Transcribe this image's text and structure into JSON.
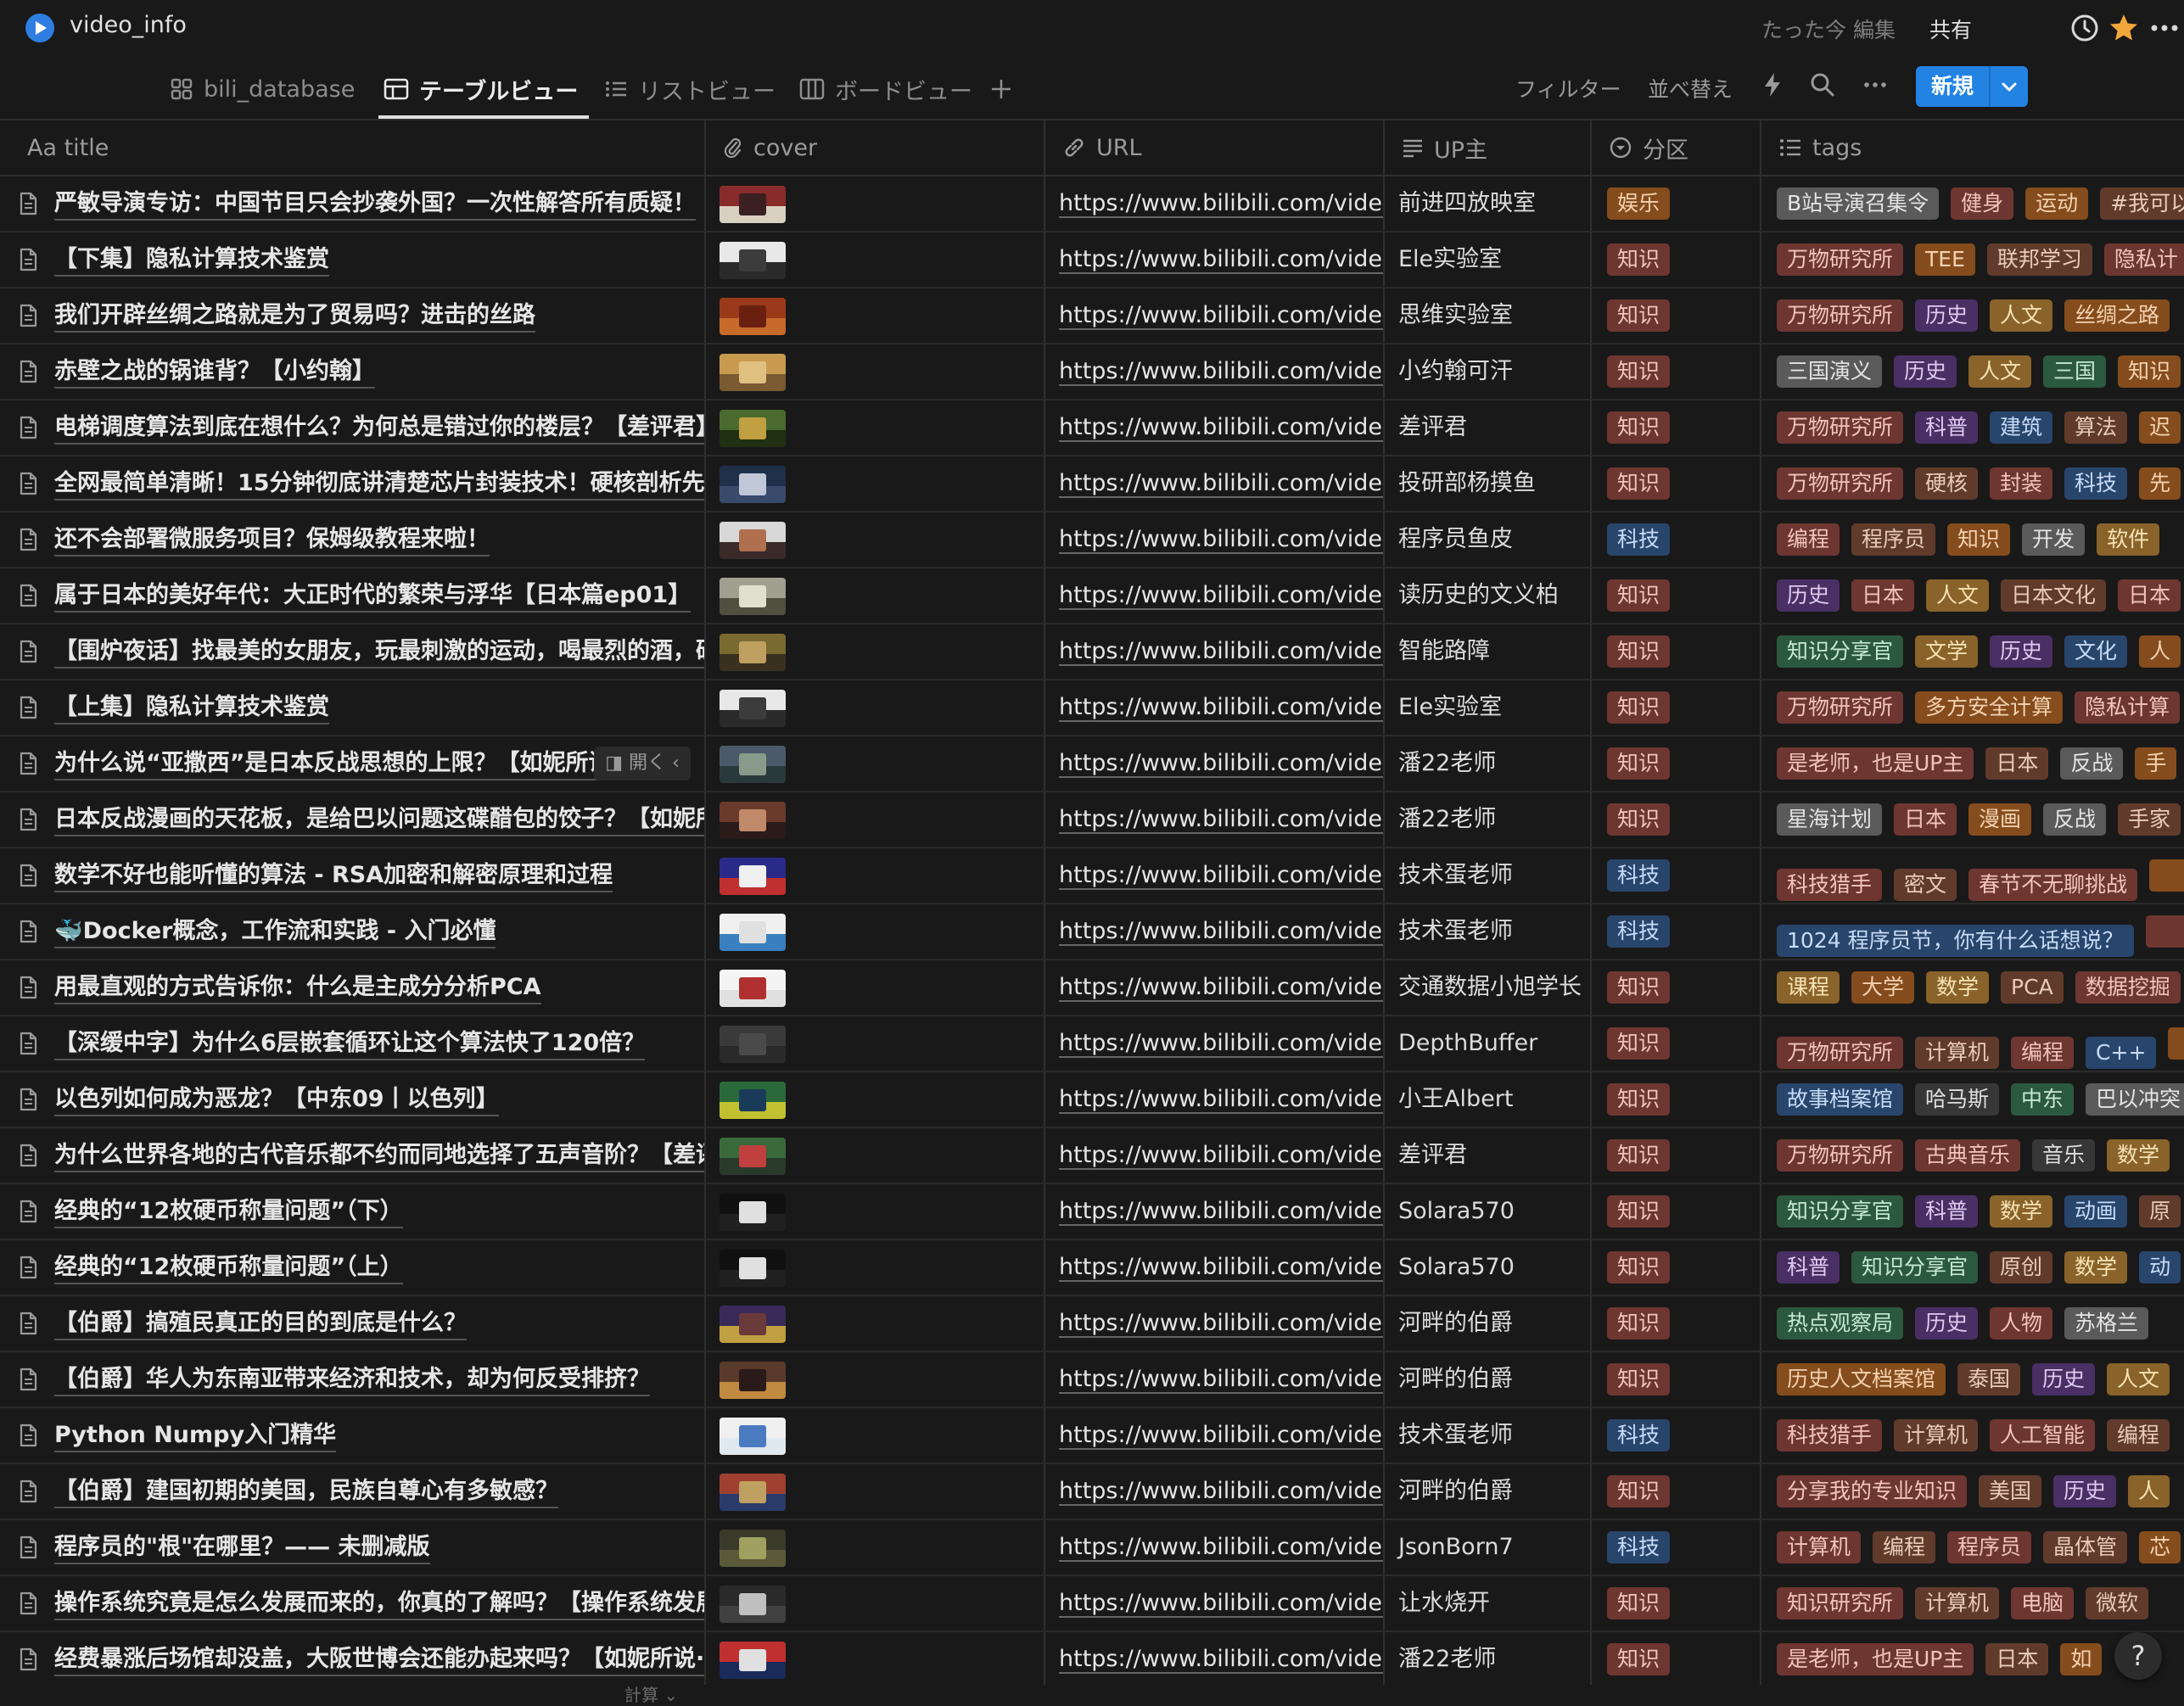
{
  "topbar": {
    "page_title": "video_info",
    "edited": "たった今 編集",
    "share": "共有"
  },
  "views": {
    "tabs": [
      {
        "label": "bili_database",
        "icon": "grid-icon"
      },
      {
        "label": "テーブルビュー",
        "icon": "table-icon",
        "active": true
      },
      {
        "label": "リストビュー",
        "icon": "list-icon"
      },
      {
        "label": "ボードビュー",
        "icon": "board-icon"
      }
    ],
    "filter": "フィルター",
    "sort": "並べ替え",
    "new_label": "新規"
  },
  "columns": {
    "title": "Aa title",
    "cover": "cover",
    "url": "URL",
    "up": "UP主",
    "category": "分区",
    "tags": "tags"
  },
  "colors": {
    "background": "#191919",
    "accent": "#2383e2"
  },
  "hover_open": "開く",
  "calc_label": "計算 ⌄",
  "help_label": "?",
  "rows": [
    {
      "title": "严敏导演专访：中国节目只会抄袭外国？一次性解答所有质疑！",
      "url": "https://www.bilibili.com/video/",
      "up": "前进四放映室",
      "category": "娱乐",
      "cat_color": "orange",
      "thumb": [
        "#8a2b2b",
        "#d8d0c0",
        "#3a2020"
      ],
      "tags": [
        {
          "t": "B站导演召集令",
          "c": "gray"
        },
        {
          "t": "健身",
          "c": "red"
        },
        {
          "t": "运动",
          "c": "orange"
        },
        {
          "t": "#我可以",
          "c": "brown"
        }
      ]
    },
    {
      "title": "【下集】隐私计算技术鉴赏",
      "url": "https://www.bilibili.com/video/",
      "up": "Ele实验室",
      "category": "知识",
      "cat_color": "red",
      "thumb": [
        "#e8e8e8",
        "#2a2a2a",
        "#3c3c3c"
      ],
      "tags": [
        {
          "t": "万物研究所",
          "c": "red"
        },
        {
          "t": "TEE",
          "c": "orange"
        },
        {
          "t": "联邦学习",
          "c": "brown"
        },
        {
          "t": "隐私计",
          "c": "red"
        }
      ]
    },
    {
      "title": "我们开辟丝绸之路就是为了贸易吗？进击的丝路",
      "url": "https://www.bilibili.com/video/",
      "up": "思维实验室",
      "category": "知识",
      "cat_color": "red",
      "thumb": [
        "#9a3a1a",
        "#c76a2a",
        "#6a2010"
      ],
      "tags": [
        {
          "t": "万物研究所",
          "c": "red"
        },
        {
          "t": "历史",
          "c": "purple"
        },
        {
          "t": "人文",
          "c": "yellow"
        },
        {
          "t": "丝绸之路",
          "c": "orange"
        }
      ]
    },
    {
      "title": "赤壁之战的锅谁背？【小约翰】",
      "url": "https://www.bilibili.com/video/",
      "up": "小约翰可汗",
      "category": "知识",
      "cat_color": "red",
      "thumb": [
        "#c89a50",
        "#7a5a30",
        "#e0c080"
      ],
      "tags": [
        {
          "t": "三国演义",
          "c": "gray"
        },
        {
          "t": "历史",
          "c": "purple"
        },
        {
          "t": "人文",
          "c": "yellow"
        },
        {
          "t": "三国",
          "c": "green"
        },
        {
          "t": "知识",
          "c": "orange"
        }
      ]
    },
    {
      "title": "电梯调度算法到底在想什么？为何总是错过你的楼层？【差评君】",
      "url": "https://www.bilibili.com/video/",
      "up": "差评君",
      "category": "知识",
      "cat_color": "red",
      "thumb": [
        "#4a6a30",
        "#203010",
        "#c0a040"
      ],
      "tags": [
        {
          "t": "万物研究所",
          "c": "red"
        },
        {
          "t": "科普",
          "c": "purple"
        },
        {
          "t": "建筑",
          "c": "blue"
        },
        {
          "t": "算法",
          "c": "brown"
        },
        {
          "t": "迟",
          "c": "orange"
        }
      ]
    },
    {
      "title": "全网最简单清晰！15分钟彻底讲清楚芯片封装技术！硬核剖析先进",
      "url": "https://www.bilibili.com/video/",
      "up": "投研部杨摸鱼",
      "category": "知识",
      "cat_color": "red",
      "thumb": [
        "#20304a",
        "#3a4a6a",
        "#c0c8d8"
      ],
      "tags": [
        {
          "t": "万物研究所",
          "c": "red"
        },
        {
          "t": "硬核",
          "c": "brown"
        },
        {
          "t": "封装",
          "c": "red"
        },
        {
          "t": "科技",
          "c": "blue"
        },
        {
          "t": "先",
          "c": "orange"
        }
      ]
    },
    {
      "title": "还不会部署微服务项目？保姆级教程来啦！",
      "url": "https://www.bilibili.com/video/",
      "up": "程序员鱼皮",
      "category": "科技",
      "cat_color": "blue",
      "thumb": [
        "#d8d8d8",
        "#3a2a2a",
        "#b07050"
      ],
      "tags": [
        {
          "t": "编程",
          "c": "red"
        },
        {
          "t": "程序员",
          "c": "brown"
        },
        {
          "t": "知识",
          "c": "orange"
        },
        {
          "t": "开发",
          "c": "gray"
        },
        {
          "t": "软件",
          "c": "yellow"
        }
      ]
    },
    {
      "title": "属于日本的美好年代：大正时代的繁荣与浮华【日本篇ep01】",
      "url": "https://www.bilibili.com/video/",
      "up": "读历史的文义柏",
      "category": "知识",
      "cat_color": "red",
      "thumb": [
        "#a0a090",
        "#505040",
        "#e0e0d0"
      ],
      "tags": [
        {
          "t": "历史",
          "c": "purple"
        },
        {
          "t": "日本",
          "c": "red"
        },
        {
          "t": "人文",
          "c": "yellow"
        },
        {
          "t": "日本文化",
          "c": "brown"
        },
        {
          "t": "日本",
          "c": "red"
        }
      ]
    },
    {
      "title": "【围炉夜话】找最美的女朋友，玩最刺激的运动，喝最烈的酒，硬核",
      "url": "https://www.bilibili.com/video/",
      "up": "智能路障",
      "category": "知识",
      "cat_color": "red",
      "thumb": [
        "#7a6a30",
        "#3a3020",
        "#c0a060"
      ],
      "tags": [
        {
          "t": "知识分享官",
          "c": "green"
        },
        {
          "t": "文学",
          "c": "yellow"
        },
        {
          "t": "历史",
          "c": "purple"
        },
        {
          "t": "文化",
          "c": "blue"
        },
        {
          "t": "人",
          "c": "orange"
        }
      ]
    },
    {
      "title": "【上集】隐私计算技术鉴赏",
      "url": "https://www.bilibili.com/video/",
      "up": "Ele实验室",
      "category": "知识",
      "cat_color": "red",
      "thumb": [
        "#e8e8e8",
        "#2a2a2a",
        "#3c3c3c"
      ],
      "tags": [
        {
          "t": "万物研究所",
          "c": "red"
        },
        {
          "t": "多方安全计算",
          "c": "orange"
        },
        {
          "t": "隐私计算",
          "c": "red"
        }
      ]
    },
    {
      "title": "为什么说“亚撒西”是日本反战思想的上限？【如妮所说",
      "url": "https://www.bilibili.com/video/",
      "up": "潘22老师",
      "category": "知识",
      "cat_color": "red",
      "hover": true,
      "thumb": [
        "#4a5a6a",
        "#2a3a3a",
        "#8a9a8a"
      ],
      "tags": [
        {
          "t": "是老师，也是UP主",
          "c": "red"
        },
        {
          "t": "日本",
          "c": "brown"
        },
        {
          "t": "反战",
          "c": "gray"
        },
        {
          "t": "手",
          "c": "orange"
        }
      ]
    },
    {
      "title": "日本反战漫画的天花板，是给巴以问题这碟醋包的饺子？【如妮所",
      "url": "https://www.bilibili.com/video/",
      "up": "潘22老师",
      "category": "知识",
      "cat_color": "red",
      "thumb": [
        "#6a3a2a",
        "#2a1a1a",
        "#c08a6a"
      ],
      "tags": [
        {
          "t": "星海计划",
          "c": "gray"
        },
        {
          "t": "日本",
          "c": "red"
        },
        {
          "t": "漫画",
          "c": "orange"
        },
        {
          "t": "反战",
          "c": "gray"
        },
        {
          "t": "手家",
          "c": "brown"
        }
      ]
    },
    {
      "title": "数学不好也能听懂的算法 - RSA加密和解密原理和过程",
      "url": "https://www.bilibili.com/video/",
      "up": "技术蛋老师",
      "category": "科技",
      "cat_color": "blue",
      "thumb": [
        "#2a2a8a",
        "#c03030",
        "#f0f0f0"
      ],
      "tags": [
        {
          "t": "科技猎手",
          "c": "red"
        },
        {
          "t": "密文",
          "c": "brown"
        },
        {
          "t": "春节不无聊挑战",
          "c": "red"
        },
        {
          "t": "",
          "c": "orange"
        }
      ]
    },
    {
      "title": "🐳Docker概念，工作流和实践 - 入门必懂",
      "url": "https://www.bilibili.com/video/",
      "up": "技术蛋老师",
      "category": "科技",
      "cat_color": "blue",
      "thumb": [
        "#f0f0f0",
        "#3a80c0",
        "#e0e0e0"
      ],
      "tags": [
        {
          "t": "1024 程序员节，你有什么话想说？",
          "c": "blue"
        },
        {
          "t": "",
          "c": "red"
        }
      ]
    },
    {
      "title": "用最直观的方式告诉你：什么是主成分分析PCA",
      "url": "https://www.bilibili.com/video/",
      "up": "交通数据小旭学长",
      "category": "知识",
      "cat_color": "red",
      "thumb": [
        "#f4f4f4",
        "#e0e0e0",
        "#b03030"
      ],
      "tags": [
        {
          "t": "课程",
          "c": "yellow"
        },
        {
          "t": "大学",
          "c": "orange"
        },
        {
          "t": "数学",
          "c": "yellow"
        },
        {
          "t": "PCA",
          "c": "brown"
        },
        {
          "t": "数据挖掘",
          "c": "red"
        }
      ]
    },
    {
      "title": "【深缓中字】为什么6层嵌套循环让这个算法快了120倍？",
      "url": "https://www.bilibili.com/video/",
      "up": "DepthBuffer",
      "category": "知识",
      "cat_color": "red",
      "thumb": [
        "#3a3a3a",
        "#2a2a2a",
        "#4a4a4a"
      ],
      "tags": [
        {
          "t": "万物研究所",
          "c": "red"
        },
        {
          "t": "计算机",
          "c": "brown"
        },
        {
          "t": "编程",
          "c": "red"
        },
        {
          "t": "C++",
          "c": "blue"
        },
        {
          "t": "",
          "c": "orange"
        }
      ]
    },
    {
      "title": "以色列如何成为恶龙？【中东09丨以色列】",
      "url": "https://www.bilibili.com/video/",
      "up": "小王Albert",
      "category": "知识",
      "cat_color": "red",
      "thumb": [
        "#2a6a3a",
        "#c0c030",
        "#1a3a5a"
      ],
      "tags": [
        {
          "t": "故事档案馆",
          "c": "blue"
        },
        {
          "t": "哈马斯",
          "c": "default"
        },
        {
          "t": "中东",
          "c": "green"
        },
        {
          "t": "巴以冲突",
          "c": "gray"
        }
      ]
    },
    {
      "title": "为什么世界各地的古代音乐都不约而同地选择了五声音阶？【差评",
      "url": "https://www.bilibili.com/video/",
      "up": "差评君",
      "category": "知识",
      "cat_color": "red",
      "thumb": [
        "#3a6a3a",
        "#2a3a2a",
        "#c04040"
      ],
      "tags": [
        {
          "t": "万物研究所",
          "c": "red"
        },
        {
          "t": "古典音乐",
          "c": "red"
        },
        {
          "t": "音乐",
          "c": "default"
        },
        {
          "t": "数学",
          "c": "yellow"
        }
      ]
    },
    {
      "title": "经典的“12枚硬币称量问题”（下）",
      "url": "https://www.bilibili.com/video/",
      "up": "Solara570",
      "category": "知识",
      "cat_color": "red",
      "thumb": [
        "#101010",
        "#202020",
        "#e0e0e0"
      ],
      "tags": [
        {
          "t": "知识分享官",
          "c": "green"
        },
        {
          "t": "科普",
          "c": "purple"
        },
        {
          "t": "数学",
          "c": "yellow"
        },
        {
          "t": "动画",
          "c": "blue"
        },
        {
          "t": "原",
          "c": "brown"
        }
      ]
    },
    {
      "title": "经典的“12枚硬币称量问题”（上）",
      "url": "https://www.bilibili.com/video/",
      "up": "Solara570",
      "category": "知识",
      "cat_color": "red",
      "thumb": [
        "#101010",
        "#202020",
        "#e0e0e0"
      ],
      "tags": [
        {
          "t": "科普",
          "c": "purple"
        },
        {
          "t": "知识分享官",
          "c": "green"
        },
        {
          "t": "原创",
          "c": "brown"
        },
        {
          "t": "数学",
          "c": "yellow"
        },
        {
          "t": "动",
          "c": "blue"
        }
      ]
    },
    {
      "title": "【伯爵】搞殖民真正的目的到底是什么？",
      "url": "https://www.bilibili.com/video/",
      "up": "河畔的伯爵",
      "category": "知识",
      "cat_color": "red",
      "thumb": [
        "#3a2a5a",
        "#c0a040",
        "#6a3a3a"
      ],
      "tags": [
        {
          "t": "热点观察局",
          "c": "green"
        },
        {
          "t": "历史",
          "c": "purple"
        },
        {
          "t": "人物",
          "c": "red"
        },
        {
          "t": "苏格兰",
          "c": "gray"
        }
      ]
    },
    {
      "title": "【伯爵】华人为东南亚带来经济和技术，却为何反受排挤？",
      "url": "https://www.bilibili.com/video/",
      "up": "河畔的伯爵",
      "category": "知识",
      "cat_color": "red",
      "thumb": [
        "#5a3a2a",
        "#c08a40",
        "#2a1a1a"
      ],
      "tags": [
        {
          "t": "历史人文档案馆",
          "c": "orange"
        },
        {
          "t": "泰国",
          "c": "brown"
        },
        {
          "t": "历史",
          "c": "purple"
        },
        {
          "t": "人文",
          "c": "yellow"
        }
      ]
    },
    {
      "title": "Python Numpy入门精华",
      "url": "https://www.bilibili.com/video/",
      "up": "技术蛋老师",
      "category": "科技",
      "cat_color": "blue",
      "thumb": [
        "#f0f0f0",
        "#e0e8f0",
        "#4a7ac0"
      ],
      "tags": [
        {
          "t": "科技猎手",
          "c": "red"
        },
        {
          "t": "计算机",
          "c": "brown"
        },
        {
          "t": "人工智能",
          "c": "red"
        },
        {
          "t": "编程",
          "c": "brown"
        }
      ]
    },
    {
      "title": "【伯爵】建国初期的美国，民族自尊心有多敏感？",
      "url": "https://www.bilibili.com/video/",
      "up": "河畔的伯爵",
      "category": "知识",
      "cat_color": "red",
      "thumb": [
        "#a04030",
        "#2a3a6a",
        "#c0a060"
      ],
      "tags": [
        {
          "t": "分享我的专业知识",
          "c": "red"
        },
        {
          "t": "美国",
          "c": "brown"
        },
        {
          "t": "历史",
          "c": "purple"
        },
        {
          "t": "人",
          "c": "yellow"
        }
      ]
    },
    {
      "title": "程序员的\"根\"在哪里？—— 未删减版",
      "url": "https://www.bilibili.com/video/",
      "up": "JsonBorn7",
      "category": "科技",
      "cat_color": "blue",
      "thumb": [
        "#3a3a2a",
        "#5a5a3a",
        "#a0a060"
      ],
      "tags": [
        {
          "t": "计算机",
          "c": "red"
        },
        {
          "t": "编程",
          "c": "brown"
        },
        {
          "t": "程序员",
          "c": "red"
        },
        {
          "t": "晶体管",
          "c": "brown"
        },
        {
          "t": "芯",
          "c": "orange"
        }
      ]
    },
    {
      "title": "操作系统究竟是怎么发展而来的，你真的了解吗？【操作系统发展",
      "url": "https://www.bilibili.com/video/",
      "up": "让水烧开",
      "category": "知识",
      "cat_color": "red",
      "thumb": [
        "#2a2a2a",
        "#404040",
        "#c0c0c0"
      ],
      "tags": [
        {
          "t": "知识研究所",
          "c": "red"
        },
        {
          "t": "计算机",
          "c": "brown"
        },
        {
          "t": "电脑",
          "c": "red"
        },
        {
          "t": "微软",
          "c": "brown"
        }
      ]
    },
    {
      "title": "经费暴涨后场馆却没盖，大阪世博会还能办起来吗？【如妮所说·海",
      "url": "https://www.bilibili.com/video/",
      "up": "潘22老师",
      "category": "知识",
      "cat_color": "red",
      "thumb": [
        "#c03030",
        "#1a2a5a",
        "#e0e0e0"
      ],
      "tags": [
        {
          "t": "是老师，也是UP主",
          "c": "red"
        },
        {
          "t": "日本",
          "c": "brown"
        },
        {
          "t": "如",
          "c": "orange"
        }
      ]
    }
  ]
}
